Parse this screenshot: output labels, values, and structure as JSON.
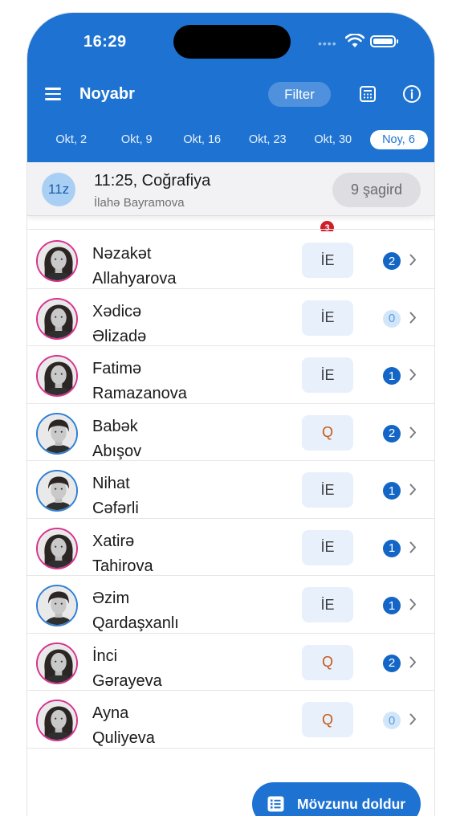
{
  "status_bar": {
    "time": "16:29"
  },
  "header": {
    "title": "Noyabr",
    "filter_label": "Filter",
    "icons": [
      "menu-icon",
      "calculator-icon",
      "info-icon"
    ]
  },
  "weeks": [
    {
      "label": "Okt, 2",
      "active": false
    },
    {
      "label": "Okt, 9",
      "active": false
    },
    {
      "label": "Okt, 16",
      "active": false
    },
    {
      "label": "Okt, 23",
      "active": false
    },
    {
      "label": "Okt, 30",
      "active": false
    },
    {
      "label": "Noy, 6",
      "active": true
    }
  ],
  "lesson": {
    "class_label": "11z",
    "title": "11:25, Coğrafiya",
    "teacher": "İlahə Bayramova",
    "students_count": "9 şagird"
  },
  "notification_count": "3",
  "students": [
    {
      "first": "Nəzakət",
      "last": "Allahyarova",
      "mark": "İE",
      "count": "2",
      "gender": "female"
    },
    {
      "first": "Xədicə",
      "last": "Əlizadə",
      "mark": "İE",
      "count": "0",
      "gender": "female"
    },
    {
      "first": "Fatimə",
      "last": "Ramazanova",
      "mark": "İE",
      "count": "1",
      "gender": "female"
    },
    {
      "first": "Babək",
      "last": "Abışov",
      "mark": "Q",
      "count": "2",
      "gender": "male"
    },
    {
      "first": "Nihat",
      "last": "Cəfərli",
      "mark": "İE",
      "count": "1",
      "gender": "male"
    },
    {
      "first": "Xatirə",
      "last": "Tahirova",
      "mark": "İE",
      "count": "1",
      "gender": "female"
    },
    {
      "first": "Əzim",
      "last": "Qardaşxanlı",
      "mark": "İE",
      "count": "1",
      "gender": "male"
    },
    {
      "first": "İnci",
      "last": "Gərayeva",
      "mark": "Q",
      "count": "2",
      "gender": "female"
    },
    {
      "first": "Ayna",
      "last": "Quliyeva",
      "mark": "Q",
      "count": "0",
      "gender": "female"
    }
  ],
  "fab_label": "Mövzunu doldur",
  "colors": {
    "primary": "#1e73d2",
    "mark_q": "#c55a17",
    "badge_red": "#cf1f2a"
  }
}
